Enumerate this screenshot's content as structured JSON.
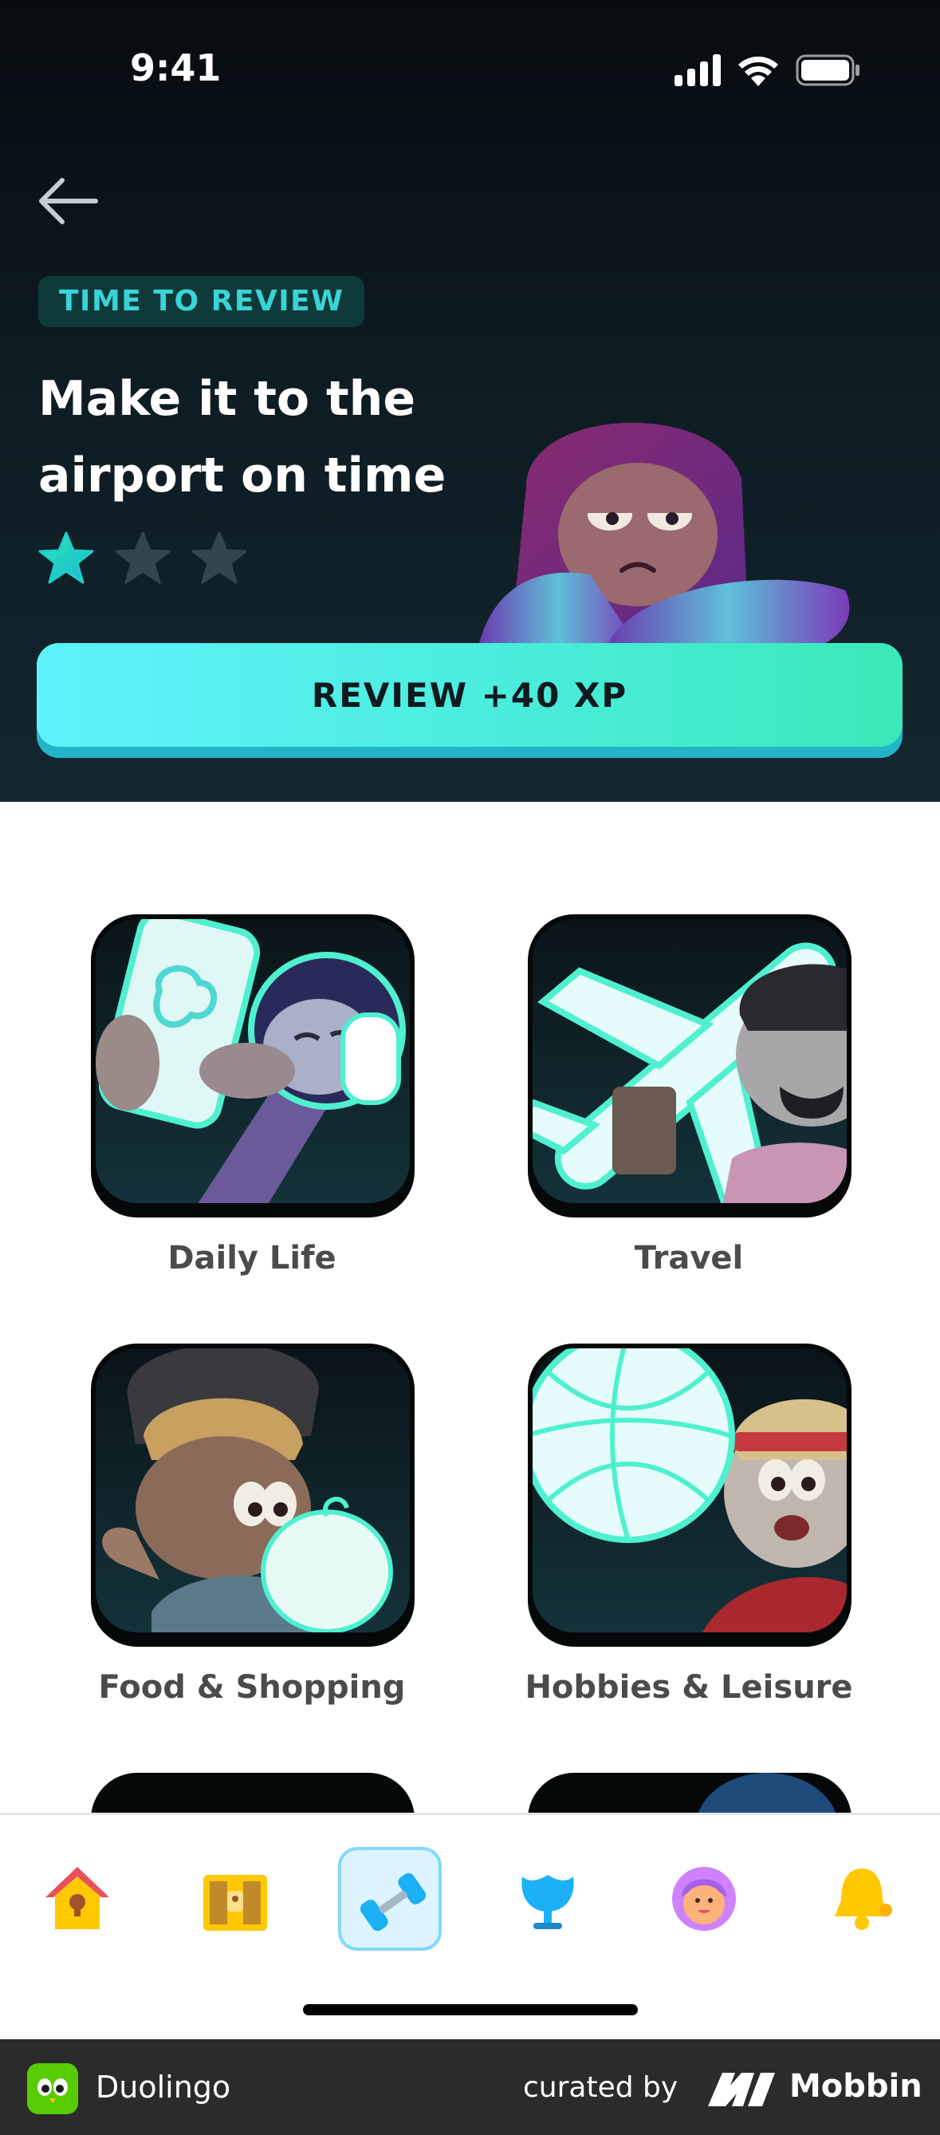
{
  "status_bar": {
    "time": "9:41"
  },
  "hero": {
    "badge": "TIME TO REVIEW",
    "title": "Make it to the airport on time",
    "stars_filled": 1,
    "stars_total": 3,
    "review_button": "REVIEW +40 XP"
  },
  "topics": [
    {
      "label": "Daily Life",
      "icon": "phone-character-illustration"
    },
    {
      "label": "Travel",
      "icon": "airplane-character-illustration"
    },
    {
      "label": "Food & Shopping",
      "icon": "apple-character-illustration"
    },
    {
      "label": "Hobbies & Leisure",
      "icon": "basketball-character-illustration"
    }
  ],
  "bottom_nav": {
    "items": [
      {
        "name": "home",
        "icon": "house-icon"
      },
      {
        "name": "chest",
        "icon": "treasure-chest-icon"
      },
      {
        "name": "practice",
        "icon": "dumbbell-icon",
        "active": true
      },
      {
        "name": "leaderboard",
        "icon": "trophy-icon"
      },
      {
        "name": "profile",
        "icon": "avatar-icon"
      },
      {
        "name": "notifications",
        "icon": "bell-icon"
      }
    ]
  },
  "footer": {
    "app_name": "Duolingo",
    "curated_by": "curated by",
    "brand": "Mobbin"
  },
  "colors": {
    "accent": "#48ecd8",
    "hero_bg": "#0d1b22",
    "label": "#4b4b4b",
    "active_nav_border": "#84d8ff"
  }
}
